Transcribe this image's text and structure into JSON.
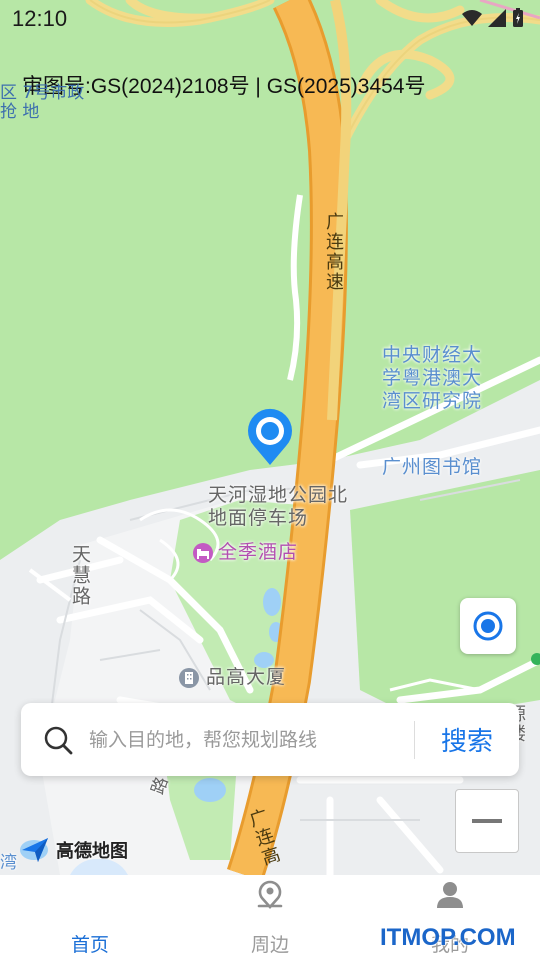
{
  "status_bar": {
    "time": "12:10"
  },
  "map": {
    "approval_number": "审图号:GS(2024)2108号 | GS(2025)3454号",
    "corner_label": "区 7号市政抢 地",
    "road_name_upper": "广连高速",
    "road_name_lower": "广连高",
    "poi": {
      "institute": "中央财经大学粤港澳大湾区研究院",
      "library": "广州图书馆",
      "park_lot": "天河湿地公园北地面停车场",
      "hotel": "全季酒店",
      "tianhui_road": "天慧路",
      "building": "品高大厦",
      "lane": "路",
      "right_edge": "源楼",
      "bottom_left": "湾"
    },
    "brand": "高德地图"
  },
  "search": {
    "placeholder": "输入目的地，帮您规划路线",
    "button": "搜索"
  },
  "nav": {
    "items": [
      {
        "label": "首页",
        "icon": "navigate-arrow-icon",
        "active": true
      },
      {
        "label": "周边",
        "icon": "nearby-pin-icon",
        "active": false
      },
      {
        "label": "我的",
        "icon": "user-icon",
        "active": false
      }
    ]
  },
  "watermark": "ITMOP.COM",
  "colors": {
    "accent": "#1976e8",
    "highway": "#f7b954",
    "green": "#b7e7a6"
  }
}
